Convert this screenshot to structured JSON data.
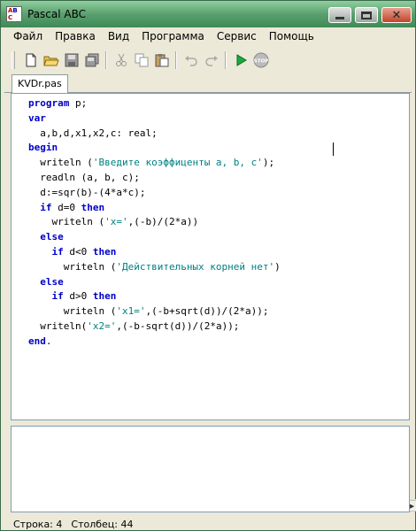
{
  "window": {
    "title": "Pascal ABC"
  },
  "menu": [
    "Файл",
    "Правка",
    "Вид",
    "Программа",
    "Сервис",
    "Помощь"
  ],
  "toolbar": {
    "icons": [
      "new-file-icon",
      "open-folder-icon",
      "save-icon",
      "save-all-icon",
      "cut-icon",
      "copy-icon",
      "paste-icon",
      "undo-icon",
      "redo-icon",
      "run-icon",
      "stop-icon"
    ],
    "stop_label": "STOP"
  },
  "tabs": [
    {
      "label": "KVDr.pas"
    }
  ],
  "editor": {
    "lines": [
      [
        {
          "t": "program",
          "k": "kw"
        },
        {
          "t": " p;"
        }
      ],
      [
        {
          "t": "var",
          "k": "kw"
        }
      ],
      [
        {
          "t": "  a,b,d,x1,x2,c: real;"
        }
      ],
      [
        {
          "t": "begin",
          "k": "kw"
        }
      ],
      [
        {
          "t": "  writeln ("
        },
        {
          "t": "'Введите коэффиценты a, b, c'",
          "k": "str"
        },
        {
          "t": ");"
        }
      ],
      [
        {
          "t": "  readln (a, b, c);"
        }
      ],
      [
        {
          "t": "  d:=sqr(b)-(4*a*c);"
        }
      ],
      [
        {
          "t": "  "
        },
        {
          "t": "if",
          "k": "kw"
        },
        {
          "t": " d=0 "
        },
        {
          "t": "then",
          "k": "kw"
        }
      ],
      [
        {
          "t": "    writeln ("
        },
        {
          "t": "'x='",
          "k": "str"
        },
        {
          "t": ",(-b)/(2*a))"
        }
      ],
      [
        {
          "t": "  "
        },
        {
          "t": "else",
          "k": "kw"
        }
      ],
      [
        {
          "t": "    "
        },
        {
          "t": "if",
          "k": "kw"
        },
        {
          "t": " d<0 "
        },
        {
          "t": "then",
          "k": "kw"
        }
      ],
      [
        {
          "t": "      writeln ("
        },
        {
          "t": "'Действительных корней нет'",
          "k": "str"
        },
        {
          "t": ")"
        }
      ],
      [
        {
          "t": "  "
        },
        {
          "t": "else",
          "k": "kw"
        }
      ],
      [
        {
          "t": "    "
        },
        {
          "t": "if",
          "k": "kw"
        },
        {
          "t": " d>0 "
        },
        {
          "t": "then",
          "k": "kw"
        }
      ],
      [
        {
          "t": "      writeln ("
        },
        {
          "t": "'x1='",
          "k": "str"
        },
        {
          "t": ",(-b+sqrt(d))/(2*a));"
        }
      ],
      [
        {
          "t": "  writeln("
        },
        {
          "t": "'x2='",
          "k": "str"
        },
        {
          "t": ",(-b-sqrt(d))/(2*a));"
        }
      ],
      [
        {
          "t": "end",
          "k": "kw"
        },
        {
          "t": "."
        }
      ]
    ]
  },
  "output": {
    "text": ""
  },
  "status": {
    "row_label": "Строка: 4",
    "col_label": "Столбец: 44"
  },
  "colors": {
    "keyword": "#0000c8",
    "string": "#008080",
    "titlebar": "#5aa06e"
  }
}
